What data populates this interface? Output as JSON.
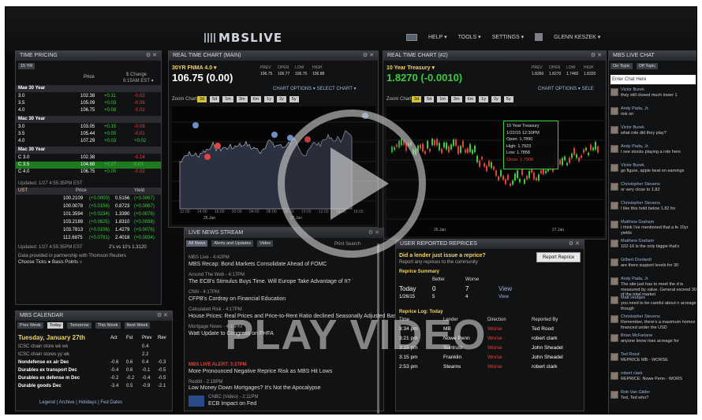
{
  "topbar": {
    "logo": "MBSLIVE",
    "menus": [
      "HELP ▾",
      "TOOLS ▾",
      "SETTINGS ▾",
      "GLENN KESZEK ▾"
    ]
  },
  "pricing": {
    "title": "TIME PRICING",
    "tab": "15 YR",
    "col_price": "Price",
    "col_change": "$ Change",
    "col_change2": "9:15AM EST ▾",
    "sec1": "Mae 30 Year",
    "sec2": "Mac 30 Year",
    "sec3": "Mac 30 Year",
    "rows1": [
      [
        "3.0",
        "102.38",
        "+0.11",
        "-0.02"
      ],
      [
        "3.5",
        "105.09",
        "+0.03",
        "-0.06"
      ],
      [
        "4.0",
        "106.75",
        "+0.08",
        "-0.02"
      ]
    ],
    "rows2": [
      [
        "3.0",
        "103.05",
        "+0.15",
        "-0.09"
      ],
      [
        "3.5",
        "105.44",
        "+0.05",
        "-0.01"
      ],
      [
        "4.0",
        "107.29",
        "+0.03",
        "+0.02"
      ]
    ],
    "rows3": [
      [
        "C 3.0",
        "102.38",
        "",
        "-0.14"
      ],
      [
        "C 3.5",
        "104.88",
        "+0.27",
        "0.03"
      ],
      [
        "C 4.0",
        "106.75",
        "+0.00",
        "-0.02"
      ]
    ],
    "updated": "Updated: 1/27 4:55:35PM EST",
    "ust_head": "UST",
    "ust_price": "Price",
    "ust_yield": "Yield",
    "ust_rows": [
      [
        "100.2109",
        "(+0.0000)",
        "0.5156",
        "(+0.0067)"
      ],
      [
        "100.0078",
        "(+0.0156)",
        "0.8723",
        "(+0.0067)"
      ],
      [
        "101.3594",
        "(+0.0234)",
        "1.3390",
        "(+0.0076)"
      ],
      [
        "103.2188",
        "(+0.0625)",
        "1.8310",
        "(+0.0098)"
      ],
      [
        "103.7813",
        "(+0.0156)",
        "1.4279",
        "(+0.0076)"
      ],
      [
        "112.6875",
        "(+0.0781)",
        "2.4018",
        "(+0.0034)"
      ]
    ],
    "ust_updated": "Updated: 1/27 4:55:35PM EST",
    "spread": "2's vs 10's 1.3120",
    "note": "Data provided in partnership with Thomson Reuters",
    "choose": "Choose Ticks ● Basis Points ○"
  },
  "calendar": {
    "title": "MBS CALENDAR",
    "tabs": [
      "Prev Week",
      "Today",
      "Tomorrow",
      "This Week",
      "Next Week"
    ],
    "date": "Tuesday, January 27th",
    "cols": [
      "Act",
      "Fst",
      "Prev",
      "Rev"
    ],
    "rows": [
      [
        "ICSC chain store wk wk",
        "",
        "",
        "0.4",
        ""
      ],
      [
        "ICSC chain stores yy wk",
        "",
        "",
        "2.2",
        ""
      ],
      [
        "Nondefense ex air Dec",
        "-0.6",
        "0.6",
        "0.4",
        "-0.3"
      ],
      [
        "Durables ex transport Dec",
        "-0.4",
        "0.6",
        "-0.1",
        "-0.5"
      ],
      [
        "Durables ex defense m Dec",
        "-0.2",
        "-0.2",
        "-0.4",
        "-0.5"
      ],
      [
        "Durable goods Dec",
        "-3.4",
        "0.5",
        "-0.9",
        "-2.1"
      ]
    ],
    "footer": "Legend | Archive | Holidays | Fed Dates"
  },
  "chart1": {
    "title": "REAL TIME CHART (MAIN)",
    "symbol": "30YR FNMA 4.0 ▾",
    "price": "106.75 (0.00)",
    "labels": [
      "PREV",
      "OPEN",
      "LOW",
      "HIGH"
    ],
    "values": [
      "106.75",
      "106.77",
      "106.75",
      "106.88"
    ],
    "options": "CHART OPTIONS ▾  SELECT CHART ▾",
    "zoom": "Zoom Chart",
    "zoom_opts": [
      "2d",
      "5d",
      "1m",
      "3m",
      "6m",
      "1y",
      "2y",
      "5y"
    ],
    "xdates": [
      "26.Jan",
      "27.Jan"
    ],
    "xtimes": [
      "12:00",
      "14:00",
      "16:00",
      "02:00",
      "04:00",
      "06:00",
      "08:00",
      "10:00",
      "12:00",
      "14:00",
      "16:00"
    ]
  },
  "chart2": {
    "title": "REAL TIME CHART (#2)",
    "symbol": "10 Year Treasury ▾",
    "price": "1.8270 (-0.0010)",
    "labels": [
      "PREV",
      "OPEN",
      "LOW",
      "HIGH"
    ],
    "values": [
      "1.8260",
      "1.8270",
      "1.7460",
      "1.8320"
    ],
    "options": "CHART OPTIONS ▾  SELE",
    "zoom": "Zoom Chart",
    "zoom_opts": [
      "2d",
      "5d",
      "1m",
      "3m",
      "6m",
      "1y",
      "2y",
      "5y"
    ],
    "tooltip": [
      "10 Year Treasury",
      "1/22/15 12:30PM",
      "Open: 1.7890",
      "High: 1.7923",
      "Low: 1.7858",
      "Close: 1.7908"
    ],
    "xdates": [
      "26.Jan",
      "27.Jan"
    ]
  },
  "news": {
    "title": "LIVE NEWS STREAM",
    "tabs": [
      "All News",
      "Alerts and Updates",
      "Video"
    ],
    "actions": "Print  Search",
    "items": [
      {
        "time": "MBS Live - 4:42PM",
        "text": "MBS Recap: Bond Markets Consolidate Ahead of FOMC"
      },
      {
        "time": "Around The Web - 4:17PM",
        "text": "The ECB's Stimulus Buys Time. Will Europe Take Advantage of It?"
      },
      {
        "time": "CNN - 4:17PM",
        "text": "CFPB's Cordray on Financial Education"
      },
      {
        "time": "Calculated Risk - 4:17PM",
        "text": "House Prices: Real Prices and Price-to-Rent Ratio declined Seasonally Adjusted Basis"
      },
      {
        "time": "Mortgage News - 4:10PM",
        "text": "Watt Update to Congress on FHFA"
      }
    ],
    "alert": "MBS LIVE ALERT: 3:27PM",
    "alert_text": "More Pronounced Negative Reprice Risk as MBS Hit Lows",
    "reddit_time": "Reddit - 2:19PM",
    "reddit_text": "Low Money Down Mortgages? It's Not the Apocalypse",
    "video_time": "CNBC (Video) - 2:11PM",
    "video_text": "ECB Impact on Fed"
  },
  "reprice": {
    "title": "USER REPORTED REPRICES",
    "prompt": "Did a lender just issue a reprice?",
    "sub": "Report any reprices to the community",
    "button": "Report Reprice",
    "summary": "Reprice Summary",
    "sum_cols": [
      "",
      "Better",
      "Worse",
      ""
    ],
    "sum_rows": [
      [
        "Today",
        "0",
        "7",
        "View"
      ],
      [
        "1/26/15",
        "5",
        "4",
        "View"
      ]
    ],
    "log": "Reprice Log: Today",
    "log_cols": [
      "Time",
      "Lender",
      "Direction",
      "Reported By"
    ],
    "log_rows": [
      [
        "3:34 pm",
        "MB",
        "Worse",
        "Ted Rood"
      ],
      [
        "3:21 pm",
        "Nowe Penn",
        "Worse",
        "robert clark"
      ],
      [
        "3:15 pm",
        "Suntrust",
        "Worse",
        "John Sheadel"
      ],
      [
        "3:15 pm",
        "Franklin",
        "Worse",
        "John Sheadel"
      ],
      [
        "2:53 pm",
        "Stearns",
        "Worse",
        "robert clark"
      ]
    ]
  },
  "chat": {
    "title": "MBS LIVE CHAT",
    "tabs": [
      "On Topic",
      "Off Topic"
    ],
    "placeholder": "Enter Chat Here",
    "messages": [
      {
        "name": "Victor Burek",
        "text": "they still closed much lower 1"
      },
      {
        "name": "Andy Pada, Jr.",
        "text": "risk on"
      },
      {
        "name": "Victor Burek",
        "text": "what role did they play?"
      },
      {
        "name": "Andy Pada, Jr.",
        "text": "I see stocks playing a role here"
      },
      {
        "name": "Victor Burek",
        "text": "go figure, apple beat on earnings"
      },
      {
        "name": "Christopher Stevens",
        "text": "or very close to 1.82"
      },
      {
        "name": "Christopher Stevens",
        "text": "I like this hold below 1.82 for"
      },
      {
        "name": "Matthew Graham",
        "text": "I think I've mentioned that a fe 10yr yields"
      },
      {
        "name": "Matthew Graham",
        "text": "102-16 is the only biggie that's"
      },
      {
        "name": "Gilbert Dordardi",
        "text": "are there support levels for 30"
      },
      {
        "name": "Andy Pada, Jr.",
        "text": "The site just has to meet the d is measured by value. General exceed 30% of the total market"
      },
      {
        "name": "Matt Hodges",
        "text": "you need to be careful about n acreage though"
      },
      {
        "name": "Christopher Stevens",
        "text": "Remember, there's a maximum homes financed under the USD"
      },
      {
        "name": "Brian McFarlane",
        "text": "anyone know max acreage for"
      },
      {
        "name": "Ted Rood",
        "text": "REPRICE MB - WORSE"
      },
      {
        "name": "robert clark",
        "text": "REPRICE: Nowe Penn - WORS"
      },
      {
        "name": "Rob Van Gilder",
        "text": "Ted, Ted who?"
      }
    ]
  },
  "overlay": {
    "play_text": "PLAY VIDEO"
  }
}
